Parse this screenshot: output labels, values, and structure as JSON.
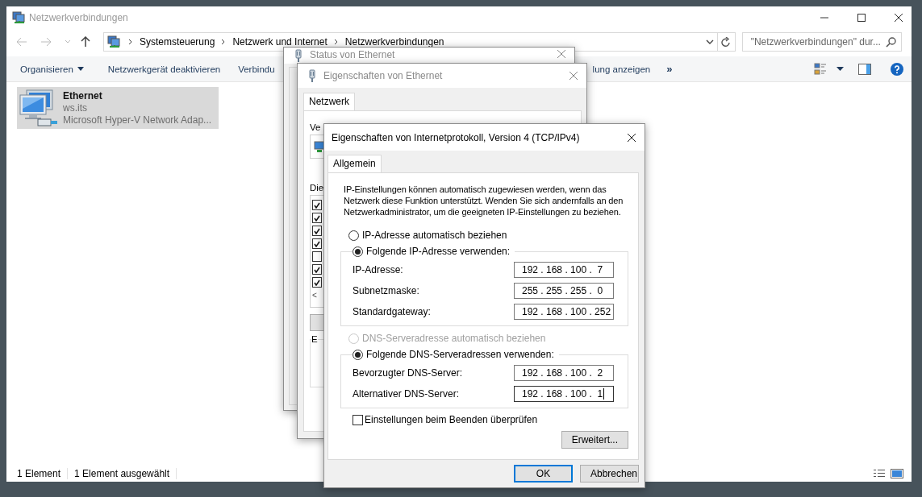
{
  "explorer": {
    "title": "Netzwerkverbindungen",
    "breadcrumb": [
      "Systemsteuerung",
      "Netzwerk und Internet",
      "Netzwerkverbindungen"
    ],
    "search": {
      "placeholder": "\"Netzwerkverbindungen\" dur..."
    },
    "toolbar": [
      {
        "label": "Organisieren",
        "kind": "menu"
      },
      {
        "label": "Netzwerkgerät deaktivieren",
        "kind": "plain"
      },
      {
        "label": "Verbindu",
        "kind": "cut"
      },
      {
        "label": "lung anzeigen",
        "kind": "resume"
      },
      {
        "label": "»",
        "kind": "overflow"
      }
    ],
    "items": [
      {
        "name": "Ethernet",
        "lines": [
          "ws.its",
          "Microsoft Hyper-V Network Adap..."
        ],
        "selected": true
      }
    ],
    "status_bar": [
      "1 Element",
      "1 Element ausgewählt"
    ]
  },
  "status_window": {
    "title": "Status von Ethernet"
  },
  "ethernet_window": {
    "title": "Eigenschaften von Ethernet",
    "tabs": [
      {
        "label": "Netzwerk",
        "selected": true
      }
    ],
    "label_1": "Ve",
    "label_2": "Die",
    "components": [
      {
        "checked": true
      },
      {
        "checked": true
      },
      {
        "checked": true
      },
      {
        "checked": true
      },
      {
        "checked": false
      },
      {
        "checked": true
      },
      {
        "checked": true
      }
    ],
    "scroll_arrow": "<",
    "group_label": "E"
  },
  "ipv4_dialog": {
    "title": "Eigenschaften von Internetprotokoll, Version 4 (TCP/IPv4)",
    "tabs": [
      {
        "label": "Allgemein",
        "selected": true
      }
    ],
    "description": "IP-Einstellungen können automatisch zugewiesen werden, wenn das Netzwerk diese Funktion unterstützt. Wenden Sie sich andernfalls an den Netzwerkadministrator, um die geeigneten IP-Einstellungen zu beziehen.",
    "ip_mode": [
      {
        "label": "IP-Adresse automatisch beziehen",
        "selected": false,
        "disabled": false
      },
      {
        "label": "Folgende IP-Adresse verwenden:",
        "selected": true,
        "disabled": false
      }
    ],
    "ip_fields": [
      {
        "label": "IP-Adresse:",
        "value": "192 . 168 . 100 .  7",
        "focused": false
      },
      {
        "label": "Subnetzmaske:",
        "value": "255 . 255 . 255 .  0",
        "focused": false
      },
      {
        "label": "Standardgateway:",
        "value": "192 . 168 . 100 . 252",
        "focused": false
      }
    ],
    "dns_mode": [
      {
        "label": "DNS-Serveradresse automatisch beziehen",
        "selected": false,
        "disabled": true
      },
      {
        "label": "Folgende DNS-Serveradressen verwenden:",
        "selected": true,
        "disabled": false
      }
    ],
    "dns_fields": [
      {
        "label": "Bevorzugter DNS-Server:",
        "value": "192 . 168 . 100 .  2",
        "focused": false
      },
      {
        "label": "Alternativer DNS-Server:",
        "value": "192 . 168 . 100 .  1",
        "focused": true
      }
    ],
    "validate": {
      "label": "Einstellungen beim Beenden überprüfen",
      "checked": false
    },
    "advanced_button": "Erweitert...",
    "buttons": [
      {
        "label": "OK",
        "default": true
      },
      {
        "label": "Abbrechen",
        "default": false
      }
    ]
  }
}
